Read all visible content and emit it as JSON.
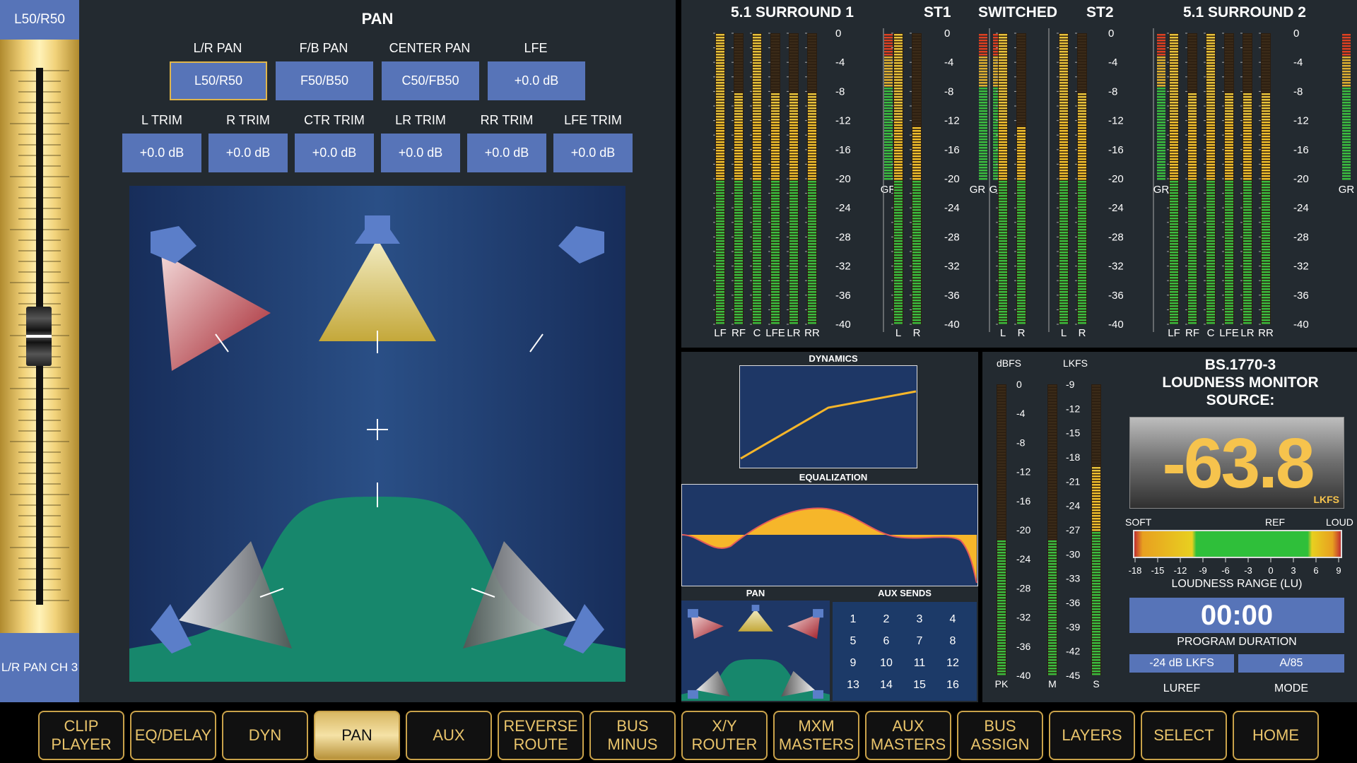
{
  "fader": {
    "top_label": "L50/R50",
    "bottom_label": "L/R PAN CH 3"
  },
  "pan": {
    "title": "PAN",
    "row1": [
      {
        "label": "L/R PAN",
        "value": "L50/R50",
        "selected": true
      },
      {
        "label": "F/B PAN",
        "value": "F50/B50"
      },
      {
        "label": "CENTER PAN",
        "value": "C50/FB50"
      },
      {
        "label": "LFE",
        "value": "+0.0 dB"
      }
    ],
    "row2": [
      {
        "label": "L TRIM",
        "value": "+0.0 dB"
      },
      {
        "label": "R TRIM",
        "value": "+0.0 dB"
      },
      {
        "label": "CTR TRIM",
        "value": "+0.0 dB"
      },
      {
        "label": "LR TRIM",
        "value": "+0.0 dB"
      },
      {
        "label": "RR TRIM",
        "value": "+0.0 dB"
      },
      {
        "label": "LFE TRIM",
        "value": "+0.0 dB"
      }
    ]
  },
  "meters": {
    "groups": [
      {
        "title": "5.1 SURROUND 1",
        "channels": [
          "LF",
          "RF",
          "C",
          "LFE",
          "LR",
          "RR"
        ],
        "levels": [
          0,
          -8,
          0,
          -8,
          -8,
          -8
        ],
        "gr": true
      },
      {
        "title": "ST1",
        "channels": [
          "L",
          "R"
        ],
        "levels": [
          0,
          -13
        ],
        "gr": true
      },
      {
        "title": "SWITCHED",
        "channels": [
          "L",
          "R"
        ],
        "levels": [
          0,
          -13
        ],
        "gr": false
      },
      {
        "title": "ST2",
        "channels": [
          "L",
          "R"
        ],
        "levels": [
          0,
          -8
        ],
        "gr": true
      },
      {
        "title": "5.1 SURROUND 2",
        "channels": [
          "LF",
          "RF",
          "C",
          "LFE",
          "LR",
          "RR"
        ],
        "levels": [
          0,
          -8,
          0,
          -8,
          -8,
          -8
        ],
        "gr": true
      }
    ],
    "scale": [
      "0",
      "-4",
      "-8",
      "-12",
      "-16",
      "-20",
      "-24",
      "-28",
      "-32",
      "-36",
      "-40"
    ],
    "gr_label": "GR"
  },
  "mini": {
    "dynamics": "DYNAMICS",
    "equalization": "EQUALIZATION",
    "pan": "PAN",
    "aux_sends": "AUX SENDS",
    "aux_numbers": [
      "1",
      "2",
      "3",
      "4",
      "5",
      "6",
      "7",
      "8",
      "9",
      "10",
      "11",
      "12",
      "13",
      "14",
      "15",
      "16"
    ]
  },
  "loudness": {
    "dbfs_label": "dBFS",
    "lkfs_label": "LKFS",
    "dbfs_scale": [
      "0",
      "-4",
      "-8",
      "-12",
      "-16",
      "-20",
      "-24",
      "-28",
      "-32",
      "-36",
      "-40"
    ],
    "lkfs_scale": [
      "-9",
      "-12",
      "-15",
      "-18",
      "-21",
      "-24",
      "-27",
      "-30",
      "-33",
      "-36",
      "-39",
      "-42",
      "-45"
    ],
    "meter_labels": [
      "PK",
      "M",
      "S"
    ],
    "head_line1": "BS.1770-3",
    "head_line2": "LOUDNESS MONITOR",
    "head_line3": "SOURCE:",
    "value": "-63.8",
    "unit": "LKFS",
    "soft": "SOFT",
    "ref": "REF",
    "loud": "LOUD",
    "range_scale": [
      "-18",
      "-15",
      "-12",
      "-9",
      "-6",
      "-3",
      "0",
      "3",
      "6",
      "9"
    ],
    "range_label": "LOUDNESS RANGE (LU)",
    "duration": "00:00",
    "duration_label": "PROGRAM DURATION",
    "luref": "-24 dB LKFS",
    "luref_label": "LUREF",
    "mode": "A/85",
    "mode_label": "MODE"
  },
  "nav": [
    {
      "label": "CLIP\nPLAYER"
    },
    {
      "label": "EQ/DELAY"
    },
    {
      "label": "DYN"
    },
    {
      "label": "PAN",
      "active": true
    },
    {
      "label": "AUX"
    },
    {
      "label": "REVERSE\nROUTE"
    },
    {
      "label": "BUS\nMINUS"
    },
    {
      "label": "X/Y\nROUTER"
    },
    {
      "label": "MXM\nMASTERS"
    },
    {
      "label": "AUX\nMASTERS"
    },
    {
      "label": "BUS\nASSIGN"
    },
    {
      "label": "LAYERS"
    },
    {
      "label": "SELECT"
    },
    {
      "label": "HOME"
    }
  ],
  "colors": {
    "button_blue": "#5774b8",
    "gold": "#c9a24a",
    "panel": "#232a30"
  }
}
